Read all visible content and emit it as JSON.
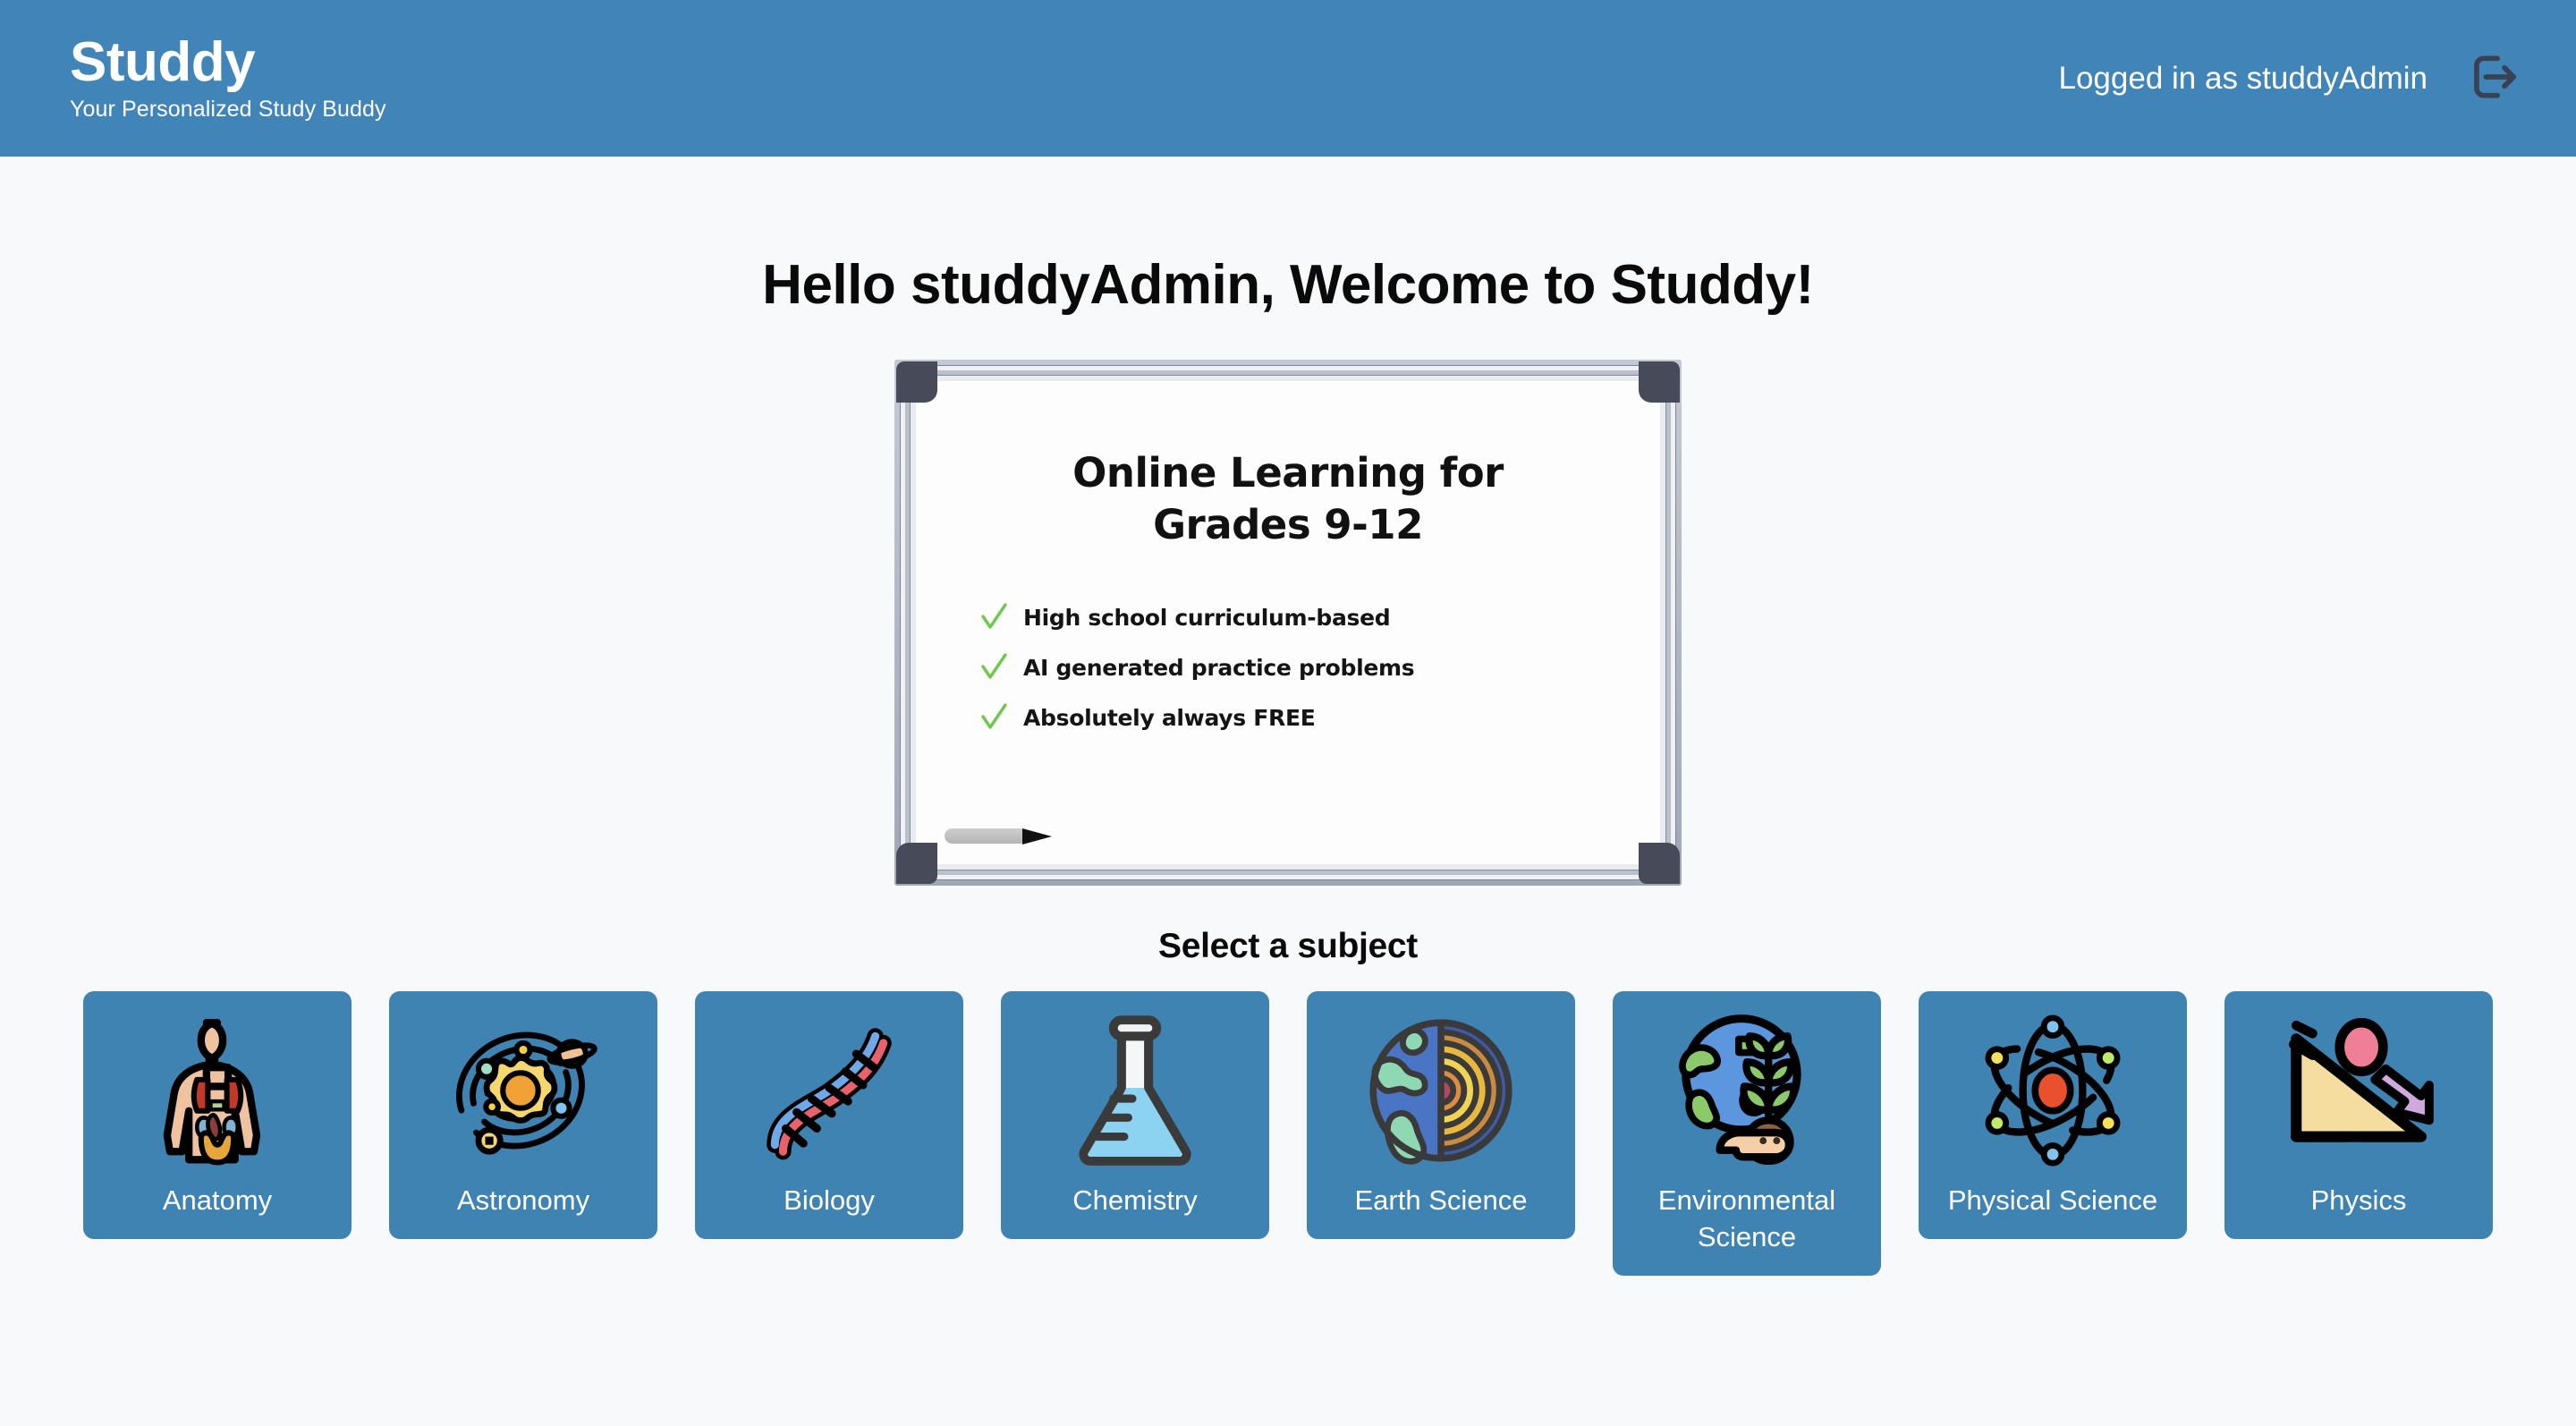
{
  "header": {
    "brand_title": "Studdy",
    "brand_tagline": "Your Personalized Study Buddy",
    "login_status": "Logged in as studdyAdmin",
    "logout_icon": "logout-icon",
    "background_color": "#4184b7",
    "text_color": "#ffffff",
    "logout_icon_color": "#3a4152"
  },
  "main": {
    "welcome_heading": "Hello studdyAdmin, Welcome to Studdy!",
    "select_subject_heading": "Select a subject",
    "background_color": "#f8f9fa"
  },
  "whiteboard": {
    "title_line1": "Online Learning for",
    "title_line2": "Grades 9-12",
    "bullets": [
      {
        "icon": "check-icon",
        "text": "High school curriculum-based"
      },
      {
        "icon": "check-icon",
        "text": "AI generated practice problems"
      },
      {
        "icon": "check-icon",
        "text": "Absolutely always FREE"
      }
    ],
    "check_color": "#6dc94a",
    "frame_color": "#b9c0cc",
    "corner_color": "#474b59",
    "marker_body_color": "#c4c4c4",
    "marker_tip_color": "#111111",
    "surface_color": "#fdfdfd"
  },
  "subjects": [
    {
      "label": "Anatomy",
      "icon": "human-body-icon"
    },
    {
      "label": "Astronomy",
      "icon": "solar-system-icon"
    },
    {
      "label": "Biology",
      "icon": "dna-helix-icon"
    },
    {
      "label": "Chemistry",
      "icon": "erlenmeyer-flask-icon"
    },
    {
      "label": "Earth Science",
      "icon": "earth-layers-icon"
    },
    {
      "label": "Environmental Science",
      "icon": "globe-plant-hand-icon"
    },
    {
      "label": "Physical Science",
      "icon": "atom-icon"
    },
    {
      "label": "Physics",
      "icon": "ball-on-incline-icon"
    }
  ],
  "theme": {
    "card_background": "#3f83b3",
    "card_label_color": "#ffffff",
    "accent_blue": "#4184b7"
  }
}
